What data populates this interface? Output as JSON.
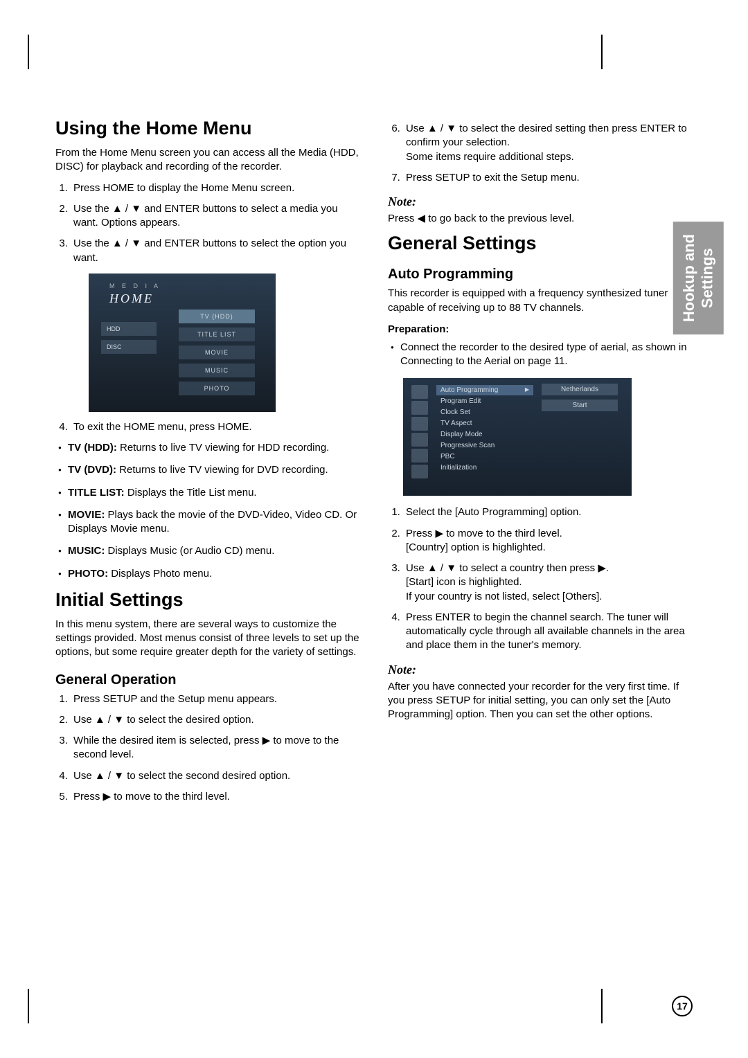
{
  "sideTab": {
    "line1": "Hookup and",
    "line2": "Settings"
  },
  "pageNumber": "17",
  "left": {
    "h1_home": "Using the Home Menu",
    "home_intro": "From the Home Menu screen you can access all the Media (HDD, DISC) for playback and recording of the recorder.",
    "home_steps": {
      "s1": "Press HOME to display the Home Menu screen.",
      "s2_a": "Use the ",
      "s2_b": " and ENTER buttons to select a media you want. Options appears.",
      "s3_a": "Use the ",
      "s3_b": " and ENTER buttons to select the option you want.",
      "s4": "To exit the HOME menu, press HOME."
    },
    "home_mock": {
      "brand": "M E D I A",
      "home_word": "HOME",
      "left_items": [
        "HDD",
        "DISC"
      ],
      "right_items": [
        "TV (HDD)",
        "TITLE LIST",
        "MOVIE",
        "MUSIC",
        "PHOTO"
      ]
    },
    "home_bullets": [
      {
        "term": "TV (HDD):",
        "desc": " Returns to live TV viewing for HDD recording."
      },
      {
        "term": "TV (DVD):",
        "desc": " Returns to live TV viewing for DVD recording."
      },
      {
        "term": "TITLE LIST:",
        "desc": " Displays the Title List menu."
      },
      {
        "term": "MOVIE:",
        "desc": " Plays back the movie of the DVD-Video, Video CD. Or Displays Movie menu."
      },
      {
        "term": "MUSIC:",
        "desc": " Displays Music (or Audio CD) menu."
      },
      {
        "term": "PHOTO:",
        "desc": " Displays Photo menu."
      }
    ],
    "h1_initial": "Initial Settings",
    "initial_intro": "In this menu system, there are several ways to customize the settings provided. Most menus consist of three levels to set up the options, but some require greater depth for the variety of settings.",
    "h2_general_op": "General Operation",
    "general_op": {
      "s1": "Press SETUP and the Setup menu appears.",
      "s2_a": "Use ",
      "s2_b": " to select the desired option.",
      "s3_a": "While the desired item is selected, press ",
      "s3_b": " to move to the second level.",
      "s4_a": "Use ",
      "s4_b": " to select the second desired option.",
      "s5_a": "Press ",
      "s5_b": " to move to the third level."
    }
  },
  "right": {
    "cont": {
      "s6_a": "Use ",
      "s6_b": " to select the desired setting then press ENTER to confirm your selection.",
      "s6_c": "Some items require additional steps.",
      "s7": "Press SETUP to exit the Setup menu."
    },
    "note1_label": "Note:",
    "note1_a": "Press ",
    "note1_b": "  to go back to the previous level.",
    "h1_general": "General Settings",
    "h2_auto": "Auto Programming",
    "auto_intro": "This recorder is equipped with a frequency synthesized tuner capable of receiving up to 88 TV channels.",
    "prep_label": "Preparation:",
    "prep_bullet": "Connect the recorder to the desired type of aerial, as shown in Connecting to the Aerial on page 11.",
    "setup_mock": {
      "list": [
        "Auto Programming",
        "Program Edit",
        "Clock Set",
        "TV Aspect",
        "Display Mode",
        "Progressive Scan",
        "PBC",
        "Initialization"
      ],
      "opts": [
        "Netherlands",
        "Start"
      ]
    },
    "auto_steps": {
      "s1": "Select the [Auto Programming] option.",
      "s2_a": "Press ",
      "s2_b": " to move to the third level.",
      "s2_c": "[Country] option is highlighted.",
      "s3_a": "Use ",
      "s3_b": " to select a country then press ",
      "s3_c": ".",
      "s3_d": "[Start] icon is highlighted.",
      "s3_e": "If your country is not listed, select [Others].",
      "s4": "Press ENTER to begin the channel search. The tuner will automatically cycle through all available channels in the area and place them in the tuner's memory."
    },
    "note2_label": "Note:",
    "note2_text": "After you have connected your recorder for the very first time. If you press SETUP for initial setting, you can only set the [Auto Programming] option. Then you can set the other options."
  },
  "glyphs": {
    "up": "▲",
    "down": "▼",
    "left": "◀",
    "right": "▶",
    "updown": "▲ / ▼"
  }
}
